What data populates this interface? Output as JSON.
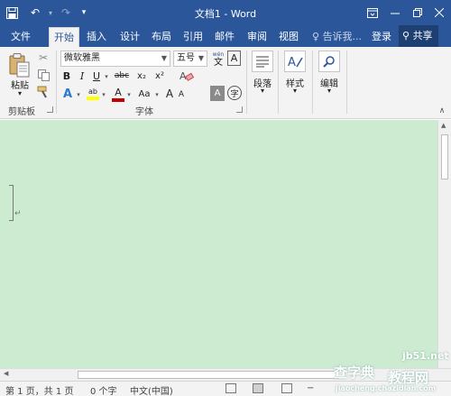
{
  "window": {
    "title": "文档1 - Word"
  },
  "quick_access": {
    "save_icon": "save-icon",
    "undo_icon": "undo-icon",
    "redo_icon": "redo-icon",
    "customize_icon": "customize-icon"
  },
  "window_controls": {
    "ribbon_options_icon": "ribbon-display-options-icon",
    "minimize_icon": "minimize-icon",
    "restore_icon": "restore-icon",
    "close_icon": "close-icon"
  },
  "tabs": [
    {
      "label": "文件"
    },
    {
      "label": "开始"
    },
    {
      "label": "插入"
    },
    {
      "label": "设计"
    },
    {
      "label": "布局"
    },
    {
      "label": "引用"
    },
    {
      "label": "邮件"
    },
    {
      "label": "审阅"
    },
    {
      "label": "视图"
    }
  ],
  "tell_me": "告诉我...",
  "login": "登录",
  "share": "共享",
  "ribbon": {
    "clipboard": {
      "group_label": "剪贴板",
      "paste_label": "粘贴"
    },
    "font": {
      "group_label": "字体",
      "font_name": "微软雅黑",
      "font_size": "五号",
      "wen_label": "wén",
      "wen_char": "文",
      "a_box": "A",
      "bold": "B",
      "italic": "I",
      "underline": "U",
      "strike": "abc",
      "sub": "x₂",
      "sup": "x²",
      "highlight": "ab",
      "font_color": "A",
      "case": "Aa",
      "grow": "A",
      "shrink": "A",
      "circle_char": "字"
    },
    "paragraph_label": "段落",
    "styles_label": "样式",
    "editing_label": "编辑"
  },
  "status": {
    "page": "第 1 页，共 1 页",
    "words": "0 个字",
    "language": "中文(中国)"
  },
  "watermark": {
    "line1": "jb51.net",
    "line2": "查字典",
    "line3": "教程网",
    "line4": "jiaocheng.chazidian.com"
  },
  "colors": {
    "brand": "#2b579a",
    "document_bg": "#cdebd0",
    "font_color_bar": "#c00000",
    "highlight_bar": "#ffff00"
  }
}
